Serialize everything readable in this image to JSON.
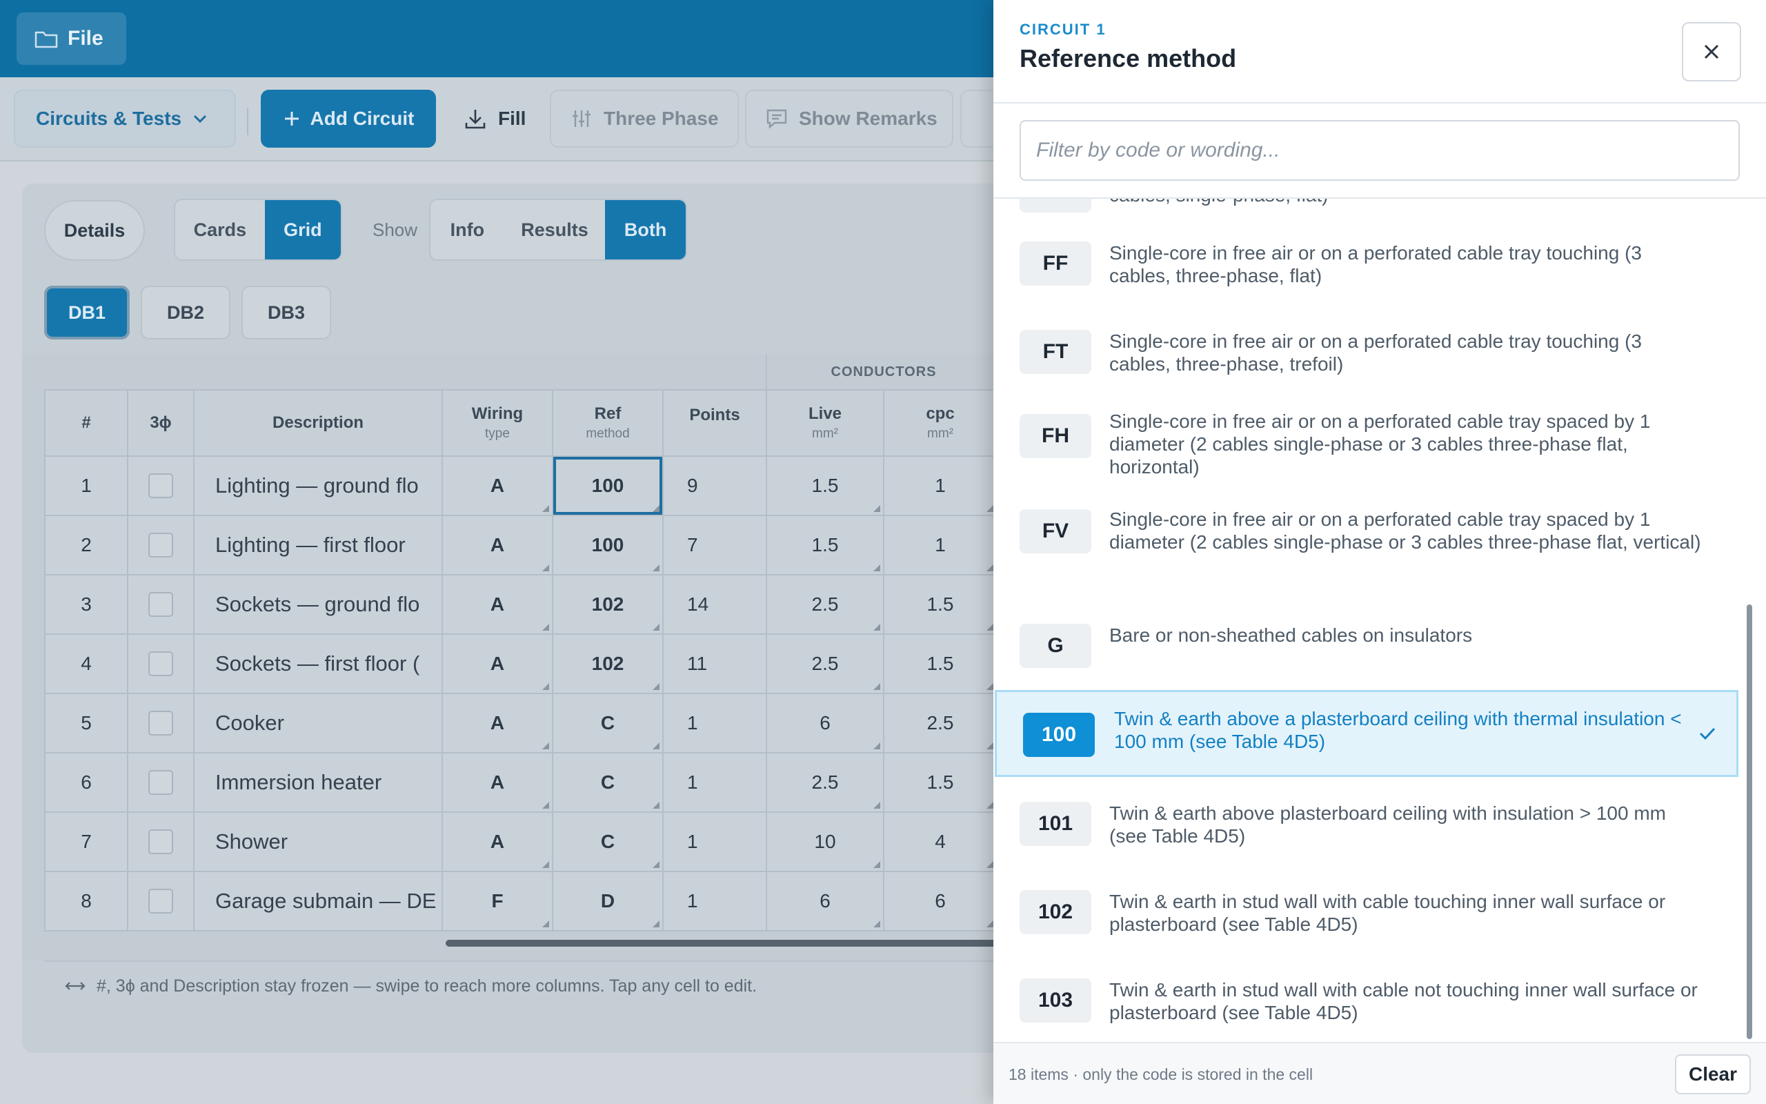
{
  "app": {
    "file_label": "File",
    "toolbar": {
      "circuits_label": "Circuits & Tests",
      "add_circuit_label": "Add Circuit",
      "fill_label": "Fill",
      "three_phase_label": "Three Phase",
      "show_remarks_label": "Show Remarks"
    },
    "view": {
      "details_label": "Details",
      "layout_tabs": [
        "Cards",
        "Grid"
      ],
      "layout_selected": "Grid",
      "show_label": "Show",
      "show_tabs": [
        "Info",
        "Results",
        "Both"
      ],
      "show_selected": "Both"
    },
    "boards": [
      "DB1",
      "DB2",
      "DB3"
    ],
    "board_selected": "DB1",
    "grid": {
      "group_header": "CONDUCTORS",
      "columns": [
        {
          "label": "#",
          "sub": ""
        },
        {
          "label": "3ϕ",
          "sub": ""
        },
        {
          "label": "Description",
          "sub": ""
        },
        {
          "label": "Wiring",
          "sub": "type"
        },
        {
          "label": "Ref",
          "sub": "method"
        },
        {
          "label": "Points",
          "sub": ""
        },
        {
          "label": "Live",
          "sub": "mm²"
        },
        {
          "label": "cpc",
          "sub": "mm²"
        }
      ],
      "rows": [
        {
          "num": "1",
          "desc": "Lighting — ground flo",
          "wiring": "A",
          "ref": "100",
          "points": "9",
          "live": "1.5",
          "cpc": "1"
        },
        {
          "num": "2",
          "desc": "Lighting — first floor",
          "wiring": "A",
          "ref": "100",
          "points": "7",
          "live": "1.5",
          "cpc": "1"
        },
        {
          "num": "3",
          "desc": "Sockets — ground flo",
          "wiring": "A",
          "ref": "102",
          "points": "14",
          "live": "2.5",
          "cpc": "1.5"
        },
        {
          "num": "4",
          "desc": "Sockets — first floor (",
          "wiring": "A",
          "ref": "102",
          "points": "11",
          "live": "2.5",
          "cpc": "1.5"
        },
        {
          "num": "5",
          "desc": "Cooker",
          "wiring": "A",
          "ref": "C",
          "points": "1",
          "live": "6",
          "cpc": "2.5"
        },
        {
          "num": "6",
          "desc": "Immersion heater",
          "wiring": "A",
          "ref": "C",
          "points": "1",
          "live": "2.5",
          "cpc": "1.5"
        },
        {
          "num": "7",
          "desc": "Shower",
          "wiring": "A",
          "ref": "C",
          "points": "1",
          "live": "10",
          "cpc": "4"
        },
        {
          "num": "8",
          "desc": "Garage submain — DE",
          "wiring": "F",
          "ref": "D",
          "points": "1",
          "live": "6",
          "cpc": "6"
        }
      ],
      "hint": "#, 3ϕ and Description stay frozen — swipe to reach more columns. Tap any cell to edit."
    }
  },
  "drawer": {
    "eyebrow": "CIRCUIT 1",
    "title": "Reference method",
    "search_placeholder": "Filter by code or wording...",
    "partial_item_text": "cables, single-phase, flat)",
    "options": [
      {
        "code": "FF",
        "text": "Single-core in free air or on a perforated cable tray touching (3 cables, three-phase, flat)"
      },
      {
        "code": "FT",
        "text": "Single-core in free air or on a perforated cable tray touching (3 cables, three-phase, trefoil)"
      },
      {
        "code": "FH",
        "text": "Single-core in free air or on a perforated cable tray spaced by 1 diameter (2 cables single-phase or 3 cables three-phase flat, horizontal)"
      },
      {
        "code": "FV",
        "text": "Single-core in free air or on a perforated cable tray spaced by 1 diameter (2 cables single-phase or 3 cables three-phase flat, vertical)"
      },
      {
        "code": "G",
        "text": "Bare or non-sheathed cables on insulators"
      },
      {
        "code": "100",
        "text": "Twin & earth above a plasterboard ceiling with thermal insulation < 100 mm (see Table 4D5)"
      },
      {
        "code": "101",
        "text": "Twin & earth above plasterboard ceiling with insulation > 100 mm (see Table 4D5)"
      },
      {
        "code": "102",
        "text": "Twin & earth in stud wall with cable touching inner wall surface or plasterboard (see Table 4D5)"
      },
      {
        "code": "103",
        "text": "Twin & earth in stud wall with cable not touching inner wall surface or plasterboard (see Table 4D5)"
      }
    ],
    "selected_code": "100",
    "footer_count": "18 items · only the code is stored in the cell",
    "clear_label": "Clear"
  },
  "colors": {
    "accent": "#0f8fd6",
    "topbar": "#0e6fa3",
    "selected_bg": "#e3f3fc"
  }
}
